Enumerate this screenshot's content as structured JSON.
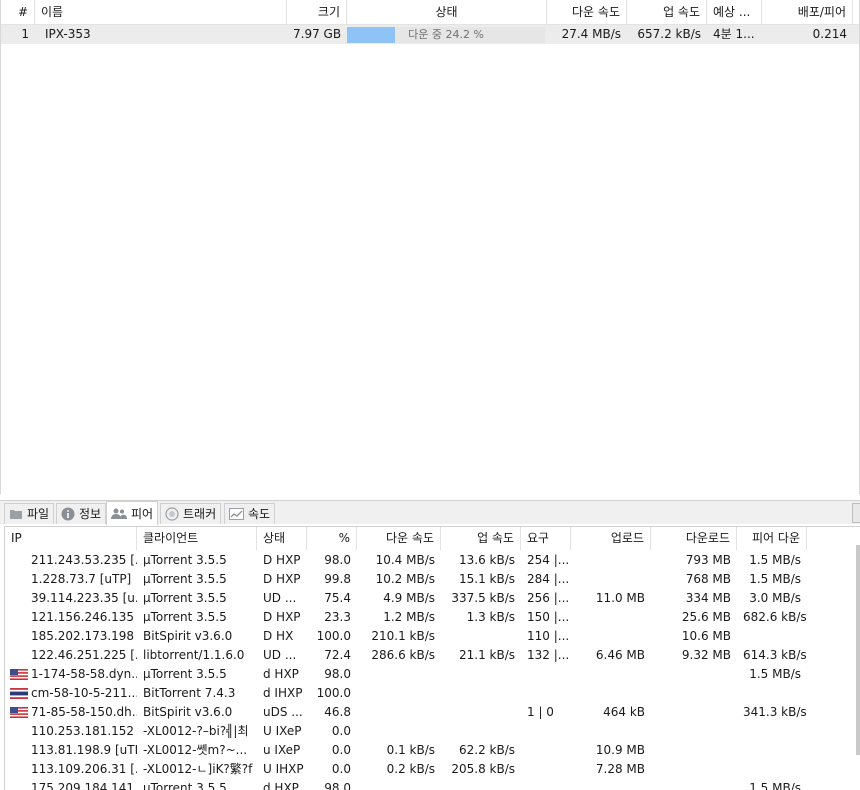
{
  "torrent_list": {
    "columns": {
      "num": "#",
      "name": "이름",
      "size": "크기",
      "status": "상태",
      "down_speed": "다운 속도",
      "up_speed": "업 속도",
      "eta": "예상 ...",
      "ratio": "배포/피어"
    },
    "rows": [
      {
        "num": "1",
        "name": "IPX-353",
        "size": "7.97 GB",
        "status_text": "다운 중 24.2 %",
        "progress": 0.242,
        "down_speed": "27.4 MB/s",
        "up_speed": "657.2 kB/s",
        "eta": "4분 1...",
        "ratio": "0.214"
      }
    ]
  },
  "tabs": [
    {
      "label": "파일",
      "icon": "folder-icon"
    },
    {
      "label": "정보",
      "icon": "info-icon"
    },
    {
      "label": "피어",
      "icon": "peers-icon",
      "active": true
    },
    {
      "label": "트래커",
      "icon": "tracker-icon"
    },
    {
      "label": "속도",
      "icon": "speed-chart-icon"
    }
  ],
  "peers": {
    "columns": {
      "ip": "IP",
      "client": "클라이언트",
      "flags": "상태",
      "percent": "%",
      "down_speed": "다운 속도",
      "up_speed": "업 속도",
      "reqs": "요구",
      "uploaded": "업로드",
      "downloaded": "다운로드",
      "peer_down": "피어 다운"
    },
    "rows": [
      {
        "flag": "",
        "ip": "211.243.53.235 [...",
        "client": "µTorrent 3.5.5",
        "flags": "D HXP",
        "percent": "98.0",
        "down_speed": "10.4 MB/s",
        "up_speed": "13.6 kB/s",
        "reqs": "254 |...",
        "uploaded": "",
        "downloaded": "793 MB",
        "peer_down": "1.5 MB/s"
      },
      {
        "flag": "",
        "ip": "1.228.73.7 [uTP]",
        "client": "µTorrent 3.5.5",
        "flags": "D HXP",
        "percent": "99.8",
        "down_speed": "10.2 MB/s",
        "up_speed": "15.1 kB/s",
        "reqs": "284 |...",
        "uploaded": "",
        "downloaded": "768 MB",
        "peer_down": "1.5 MB/s"
      },
      {
        "flag": "",
        "ip": "39.114.223.35 [u...",
        "client": "µTorrent 3.5.5",
        "flags": "UD ...",
        "percent": "75.4",
        "down_speed": "4.9 MB/s",
        "up_speed": "337.5 kB/s",
        "reqs": "256 |...",
        "uploaded": "11.0 MB",
        "downloaded": "334 MB",
        "peer_down": "3.0 MB/s"
      },
      {
        "flag": "",
        "ip": "121.156.246.135 ...",
        "client": "µTorrent 3.5.5",
        "flags": "D HXP",
        "percent": "23.3",
        "down_speed": "1.2 MB/s",
        "up_speed": "1.3 kB/s",
        "reqs": "150 |...",
        "uploaded": "",
        "downloaded": "25.6 MB",
        "peer_down": "682.6 kB/s"
      },
      {
        "flag": "",
        "ip": "185.202.173.198",
        "client": "BitSpirit v3.6.0",
        "flags": "D HX",
        "percent": "100.0",
        "down_speed": "210.1 kB/s",
        "up_speed": "",
        "reqs": "110 |...",
        "uploaded": "",
        "downloaded": "10.6 MB",
        "peer_down": ""
      },
      {
        "flag": "",
        "ip": "122.46.251.225 [...",
        "client": "libtorrent/1.1.6.0",
        "flags": "UD ...",
        "percent": "72.4",
        "down_speed": "286.6 kB/s",
        "up_speed": "21.1 kB/s",
        "reqs": "132 |...",
        "uploaded": "6.46 MB",
        "downloaded": "9.32 MB",
        "peer_down": "614.3 kB/s"
      },
      {
        "flag": "us",
        "ip": "1-174-58-58.dyn...",
        "client": "µTorrent 3.5.5",
        "flags": "d HXP",
        "percent": "98.0",
        "down_speed": "",
        "up_speed": "",
        "reqs": "",
        "uploaded": "",
        "downloaded": "",
        "peer_down": "1.5 MB/s"
      },
      {
        "flag": "th",
        "ip": "cm-58-10-5-211....",
        "client": "BitTorrent 7.4.3",
        "flags": "d IHXP",
        "percent": "100.0",
        "down_speed": "",
        "up_speed": "",
        "reqs": "",
        "uploaded": "",
        "downloaded": "",
        "peer_down": ""
      },
      {
        "flag": "us",
        "ip": "71-85-58-150.dh...",
        "client": "BitSpirit v3.6.0",
        "flags": "uDS ...",
        "percent": "46.8",
        "down_speed": "",
        "up_speed": "",
        "reqs": "1 | 0",
        "uploaded": "464 kB",
        "downloaded": "",
        "peer_down": "341.3 kB/s"
      },
      {
        "flag": "",
        "ip": "110.253.181.152 ...",
        "client": "-XL0012-?–bi?╣|최",
        "flags": "U IXeP",
        "percent": "0.0",
        "down_speed": "",
        "up_speed": "",
        "reqs": "",
        "uploaded": "",
        "downloaded": "",
        "peer_down": ""
      },
      {
        "flag": "",
        "ip": "113.81.198.9 [uTP]",
        "client": "-XL0012-쏏m?~...",
        "flags": "u IXeP",
        "percent": "0.0",
        "down_speed": "0.1 kB/s",
        "up_speed": "62.2 kB/s",
        "reqs": "",
        "uploaded": "10.9 MB",
        "downloaded": "",
        "peer_down": ""
      },
      {
        "flag": "",
        "ip": "113.109.206.31 [...",
        "client": "-XL0012-ㄴ]iK?繁?f",
        "flags": "U IHXP",
        "percent": "0.0",
        "down_speed": "0.2 kB/s",
        "up_speed": "205.8 kB/s",
        "reqs": "",
        "uploaded": "7.28 MB",
        "downloaded": "",
        "peer_down": ""
      },
      {
        "flag": "",
        "ip": "175.209.184.141",
        "client": "µTorrent 3.5.5",
        "flags": "d HXP",
        "percent": "98.0",
        "down_speed": "",
        "up_speed": "",
        "reqs": "",
        "uploaded": "",
        "downloaded": "",
        "peer_down": "1.5 MB/s"
      }
    ]
  },
  "colors": {
    "progress_fill": "#8ec3f5",
    "selected_row": "#ececec"
  }
}
